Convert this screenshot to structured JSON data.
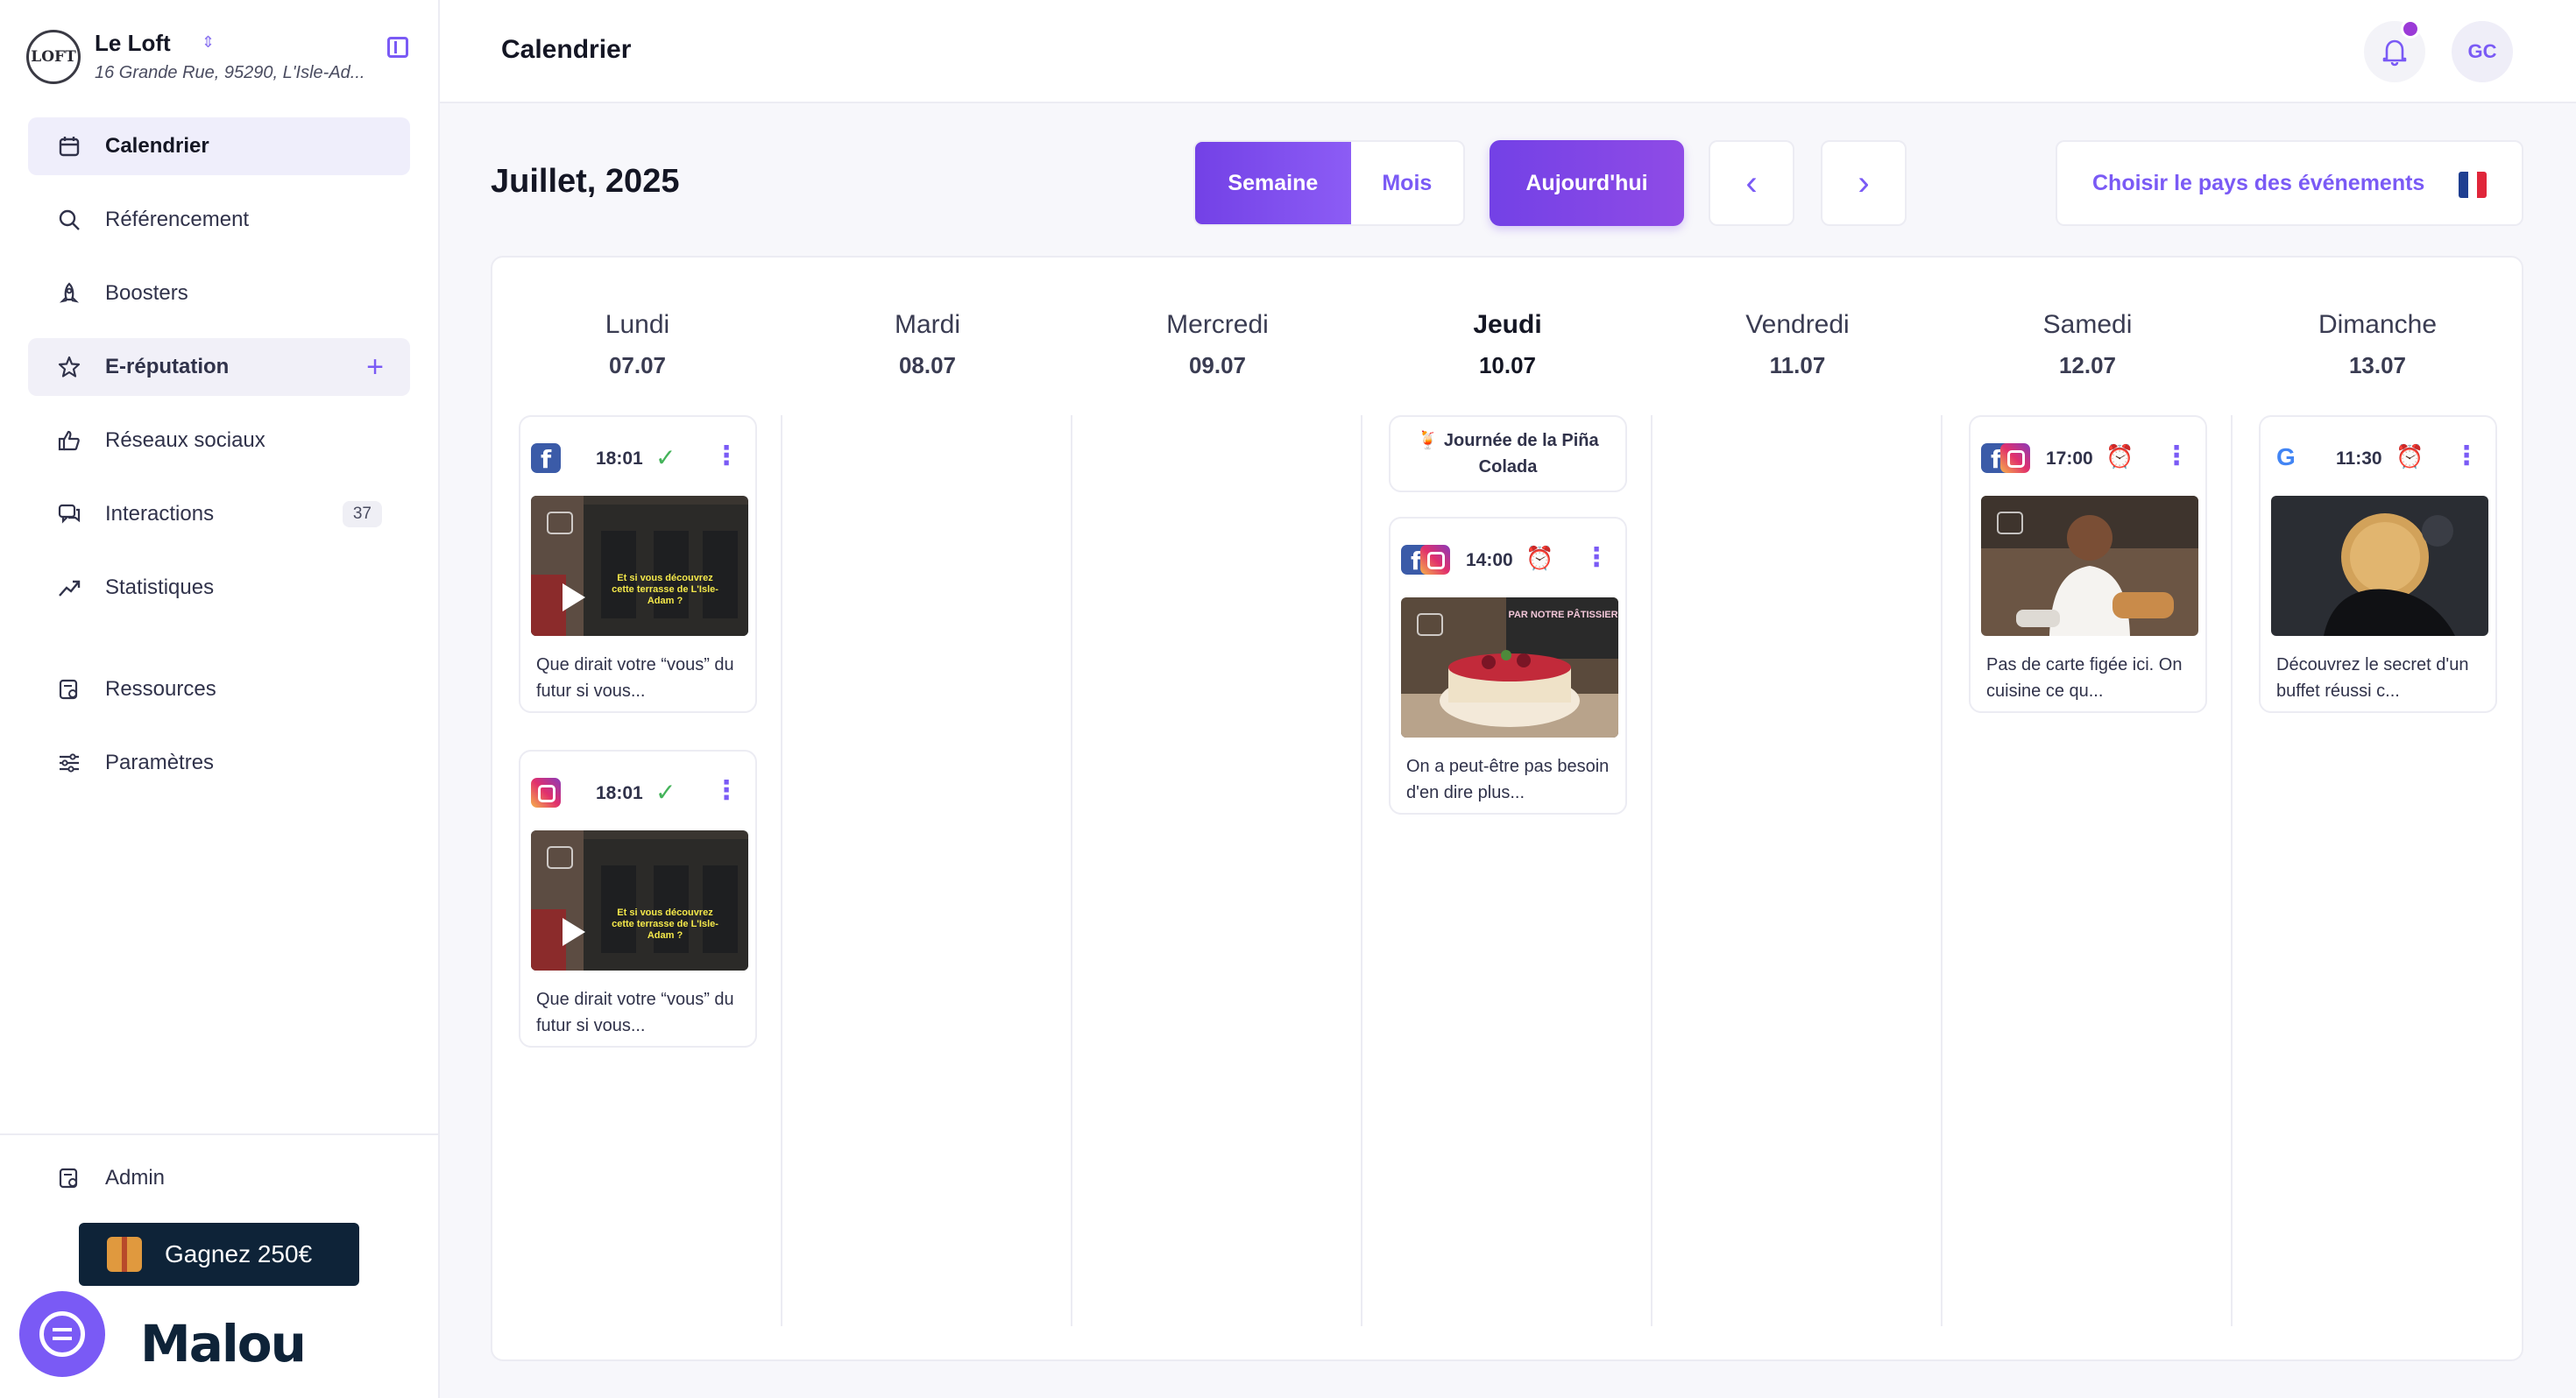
{
  "brand": {
    "name": "Le Loft",
    "logo_text": "LOFT",
    "address": "16 Grande Rue, 95290, L'Isle-Ad..."
  },
  "sidebar": {
    "items": [
      {
        "label": "Calendrier",
        "icon": "calendar-icon"
      },
      {
        "label": "Référencement",
        "icon": "search-icon"
      },
      {
        "label": "Boosters",
        "icon": "rocket-icon"
      },
      {
        "label": "E-réputation",
        "icon": "star-icon"
      },
      {
        "label": "Réseaux sociaux",
        "icon": "thumbs-up-icon"
      },
      {
        "label": "Interactions",
        "icon": "chat-icon",
        "badge": "37"
      },
      {
        "label": "Statistiques",
        "icon": "trending-up-icon"
      },
      {
        "label": "Ressources",
        "icon": "folder-icon"
      },
      {
        "label": "Paramètres",
        "icon": "sliders-icon"
      }
    ],
    "admin_label": "Admin",
    "promo_label": "Gagnez 250€",
    "logo_text": "Malou"
  },
  "header": {
    "title": "Calendrier",
    "avatar_initials": "GC"
  },
  "controls": {
    "month_title": "Juillet, 2025",
    "week_label": "Semaine",
    "month_label": "Mois",
    "today_label": "Aujourd'hui",
    "prev_symbol": "‹",
    "next_symbol": "›",
    "country_label": "Choisir le pays des événements",
    "flag_colors": [
      "#1f3f91",
      "#ffffff",
      "#e0263a"
    ]
  },
  "days": [
    {
      "name": "Lundi",
      "date": "07.07"
    },
    {
      "name": "Mardi",
      "date": "08.07"
    },
    {
      "name": "Mercredi",
      "date": "09.07"
    },
    {
      "name": "Jeudi",
      "date": "10.07",
      "today": true
    },
    {
      "name": "Vendredi",
      "date": "11.07"
    },
    {
      "name": "Samedi",
      "date": "12.07"
    },
    {
      "name": "Dimanche",
      "date": "13.07"
    }
  ],
  "event": {
    "emoji": "🍹",
    "label": "Journée de la Piña Colada"
  },
  "posts": {
    "mon1": {
      "time": "18:01",
      "status": "✓",
      "text": "Que dirait votre “vous” du futur si vous...",
      "networks": [
        "facebook"
      ],
      "media_caption": "Et si vous découvrez cette terrasse de L'Isle-Adam ?"
    },
    "mon2": {
      "time": "18:01",
      "status": "✓",
      "text": "Que dirait votre “vous” du futur si vous...",
      "networks": [
        "instagram"
      ],
      "media_caption": "Et si vous découvrez cette terrasse de L'Isle-Adam ?"
    },
    "thu1": {
      "time": "14:00",
      "status": "⏰",
      "text": "On a peut-être pas besoin d'en dire plus...",
      "networks": [
        "facebook",
        "instagram"
      ],
      "media_caption": "PAR NOTRE PÂTISSIER"
    },
    "sat1": {
      "time": "17:00",
      "status": "⏰",
      "text": "Pas de carte figée ici. On cuisine ce qu...",
      "networks": [
        "facebook",
        "instagram"
      ]
    },
    "sun1": {
      "time": "11:30",
      "status": "⏰",
      "text": "Découvrez le secret d'un buffet réussi c...",
      "networks": [
        "google"
      ]
    }
  },
  "colors": {
    "accent": "#7a5af5",
    "accent_dark": "#7341e6",
    "success": "#44b35a",
    "pending": "#f0a33a",
    "promo_bg": "#0e2338"
  }
}
